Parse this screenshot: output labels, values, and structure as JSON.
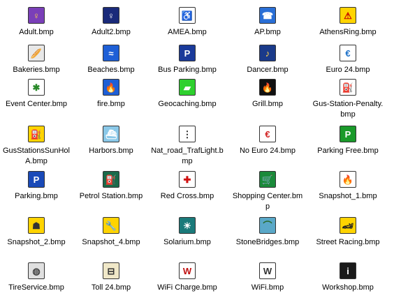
{
  "files": [
    {
      "name": "Adult.bmp",
      "icon": "adult-icon",
      "glyph": "♀",
      "bg": "#7a3fb8",
      "fg": "#ffd24a"
    },
    {
      "name": "Adult2.bmp",
      "icon": "adult2-icon",
      "glyph": "♀",
      "bg": "#1a2a7a",
      "fg": "#ffffff"
    },
    {
      "name": "AMEA.bmp",
      "icon": "wheelchair-icon",
      "glyph": "♿",
      "bg": "#ffffff",
      "fg": "#1a4aa8"
    },
    {
      "name": "AP.bmp",
      "icon": "phone-icon",
      "glyph": "☎",
      "bg": "#2a6fd6",
      "fg": "#ffffff"
    },
    {
      "name": "AthensRing.bmp",
      "icon": "warning-triangle-icon",
      "glyph": "⚠",
      "bg": "#ffd400",
      "fg": "#c40000"
    },
    {
      "name": "Bakeries.bmp",
      "icon": "bread-icon",
      "glyph": "🥖",
      "bg": "#e8e8e8",
      "fg": "#555555"
    },
    {
      "name": "Beaches.bmp",
      "icon": "swimmer-icon",
      "glyph": "≈",
      "bg": "#1e5fd6",
      "fg": "#ffffff"
    },
    {
      "name": "Bus Parking.bmp",
      "icon": "bus-parking-icon",
      "glyph": "P",
      "bg": "#1a3a9a",
      "fg": "#ffffff"
    },
    {
      "name": "Dancer.bmp",
      "icon": "dancer-icon",
      "glyph": "♪",
      "bg": "#1a3a8a",
      "fg": "#ffd24a"
    },
    {
      "name": "Euro 24.bmp",
      "icon": "euro-icon",
      "glyph": "€",
      "bg": "#ffffff",
      "fg": "#1a6fc8"
    },
    {
      "name": "Event Center.bmp",
      "icon": "event-center-icon",
      "glyph": "✱",
      "bg": "#ffffff",
      "fg": "#2a8a2a"
    },
    {
      "name": "fire.bmp",
      "icon": "fire-icon",
      "glyph": "🔥",
      "bg": "#1e5fd6",
      "fg": "#ff8a00"
    },
    {
      "name": "Geocaching.bmp",
      "icon": "geocaching-icon",
      "glyph": "▰",
      "bg": "#2ed02e",
      "fg": "#ffffff"
    },
    {
      "name": "Grill.bmp",
      "icon": "grill-icon",
      "glyph": "🔥",
      "bg": "#111111",
      "fg": "#ff6a00"
    },
    {
      "name": "Gus-Station-Penalty.bmp",
      "icon": "gas-station-penalty-icon",
      "glyph": "⛽",
      "bg": "#ffffff",
      "fg": "#c40000"
    },
    {
      "name": "GusStationsSunHolA.bmp",
      "icon": "gas-station-icon",
      "glyph": "⛽",
      "bg": "#ffd400",
      "fg": "#222222"
    },
    {
      "name": "Harbors.bmp",
      "icon": "ship-icon",
      "glyph": "⛴",
      "bg": "#8ac8e8",
      "fg": "#ffffff"
    },
    {
      "name": "Nat_road_TrafLight.bmp",
      "icon": "traffic-light-icon",
      "glyph": "⋮",
      "bg": "#ffffff",
      "fg": "#222222"
    },
    {
      "name": "No Euro 24.bmp",
      "icon": "no-euro-icon",
      "glyph": "€",
      "bg": "#ffffff",
      "fg": "#d22222"
    },
    {
      "name": "Parking Free.bmp",
      "icon": "parking-free-icon",
      "glyph": "P",
      "bg": "#1a9a2a",
      "fg": "#ffffff"
    },
    {
      "name": "Parking.bmp",
      "icon": "parking-icon",
      "glyph": "P",
      "bg": "#1a4ab8",
      "fg": "#ffffff"
    },
    {
      "name": "Petrol Station.bmp",
      "icon": "petrol-pump-icon",
      "glyph": "⛽",
      "bg": "#1a6a4a",
      "fg": "#ffffff"
    },
    {
      "name": "Red Cross.bmp",
      "icon": "red-cross-icon",
      "glyph": "✚",
      "bg": "#ffffff",
      "fg": "#d01010"
    },
    {
      "name": "Shopping Center.bmp",
      "icon": "shopping-cart-icon",
      "glyph": "🛒",
      "bg": "#1a8a3a",
      "fg": "#ffffff"
    },
    {
      "name": "Snapshot_1.bmp",
      "icon": "flame-icon",
      "glyph": "🔥",
      "bg": "#ffffff",
      "fg": "#ff7a00"
    },
    {
      "name": "Snapshot_2.bmp",
      "icon": "snapshot-yellow-icon",
      "glyph": "☗",
      "bg": "#ffd400",
      "fg": "#333333"
    },
    {
      "name": "Snapshot_4.bmp",
      "icon": "wrench-icon",
      "glyph": "🔧",
      "bg": "#ffd400",
      "fg": "#222222"
    },
    {
      "name": "Solarium.bmp",
      "icon": "solarium-icon",
      "glyph": "☀",
      "bg": "#1a7a7a",
      "fg": "#ffffff"
    },
    {
      "name": "StoneBridges.bmp",
      "icon": "stone-bridge-icon",
      "glyph": "⌒",
      "bg": "#5aa8c8",
      "fg": "#2a6a2a"
    },
    {
      "name": "Street Racing.bmp",
      "icon": "race-car-icon",
      "glyph": "🏎",
      "bg": "#ffd400",
      "fg": "#222222"
    },
    {
      "name": "TireService.bmp",
      "icon": "tire-icon",
      "glyph": "◍",
      "bg": "#e0e0e0",
      "fg": "#444444"
    },
    {
      "name": "Toll 24.bmp",
      "icon": "toll-icon",
      "glyph": "⊟",
      "bg": "#f0e8c8",
      "fg": "#333333"
    },
    {
      "name": "WiFi Charge.bmp",
      "icon": "wifi-charge-icon",
      "glyph": "W",
      "bg": "#ffffff",
      "fg": "#c01010"
    },
    {
      "name": "WiFi.bmp",
      "icon": "wifi-icon",
      "glyph": "W",
      "bg": "#ffffff",
      "fg": "#333333"
    },
    {
      "name": "Workshop.bmp",
      "icon": "info-icon",
      "glyph": "i",
      "bg": "#1a1a1a",
      "fg": "#ffffff"
    }
  ]
}
